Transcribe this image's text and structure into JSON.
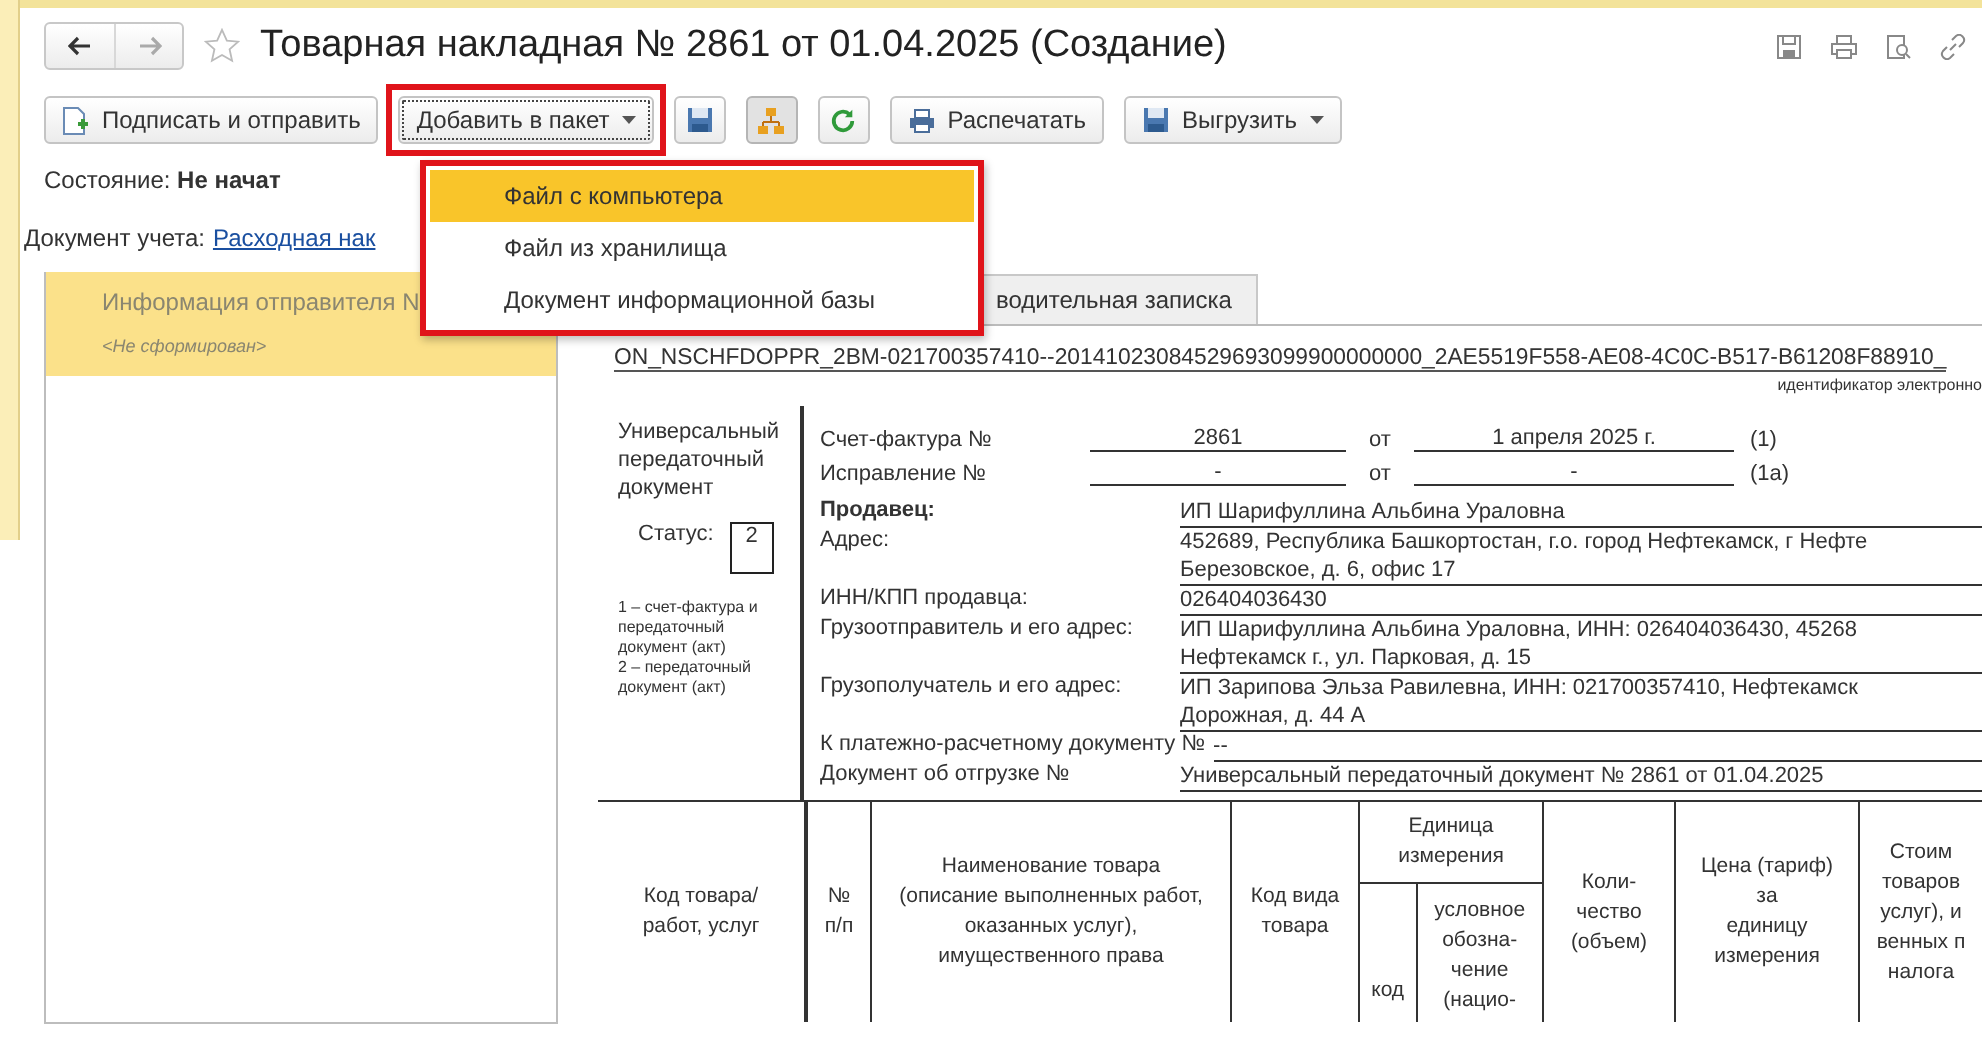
{
  "window": {
    "title": "Товарная накладная № 2861 от 01.04.2025 (Создание)"
  },
  "toolbar": [
    {
      "kind": "sign",
      "label": "Подписать и отправить",
      "pressed": false,
      "highlighted": false
    },
    {
      "kind": "add",
      "label": "Добавить в пакет",
      "pressed": false,
      "highlighted": true
    },
    {
      "kind": "save",
      "pressed": false,
      "highlighted": false
    },
    {
      "kind": "structure",
      "pressed": true,
      "highlighted": false
    },
    {
      "kind": "refresh",
      "pressed": false,
      "highlighted": false
    },
    {
      "kind": "print",
      "label": "Распечатать",
      "pressed": false,
      "highlighted": false
    },
    {
      "kind": "export",
      "label": "Выгрузить",
      "pressed": false,
      "highlighted": false
    }
  ],
  "menu": {
    "highlighted": true,
    "items": [
      {
        "label": "Файл с компьютера",
        "selected": true
      },
      {
        "label": "Файл из хранилища",
        "selected": false
      },
      {
        "label": "Документ информационной базы",
        "selected": false
      }
    ]
  },
  "state": "Состояние: **Не начат**",
  "document_link": {
    "label": "Документ учета:",
    "link": "Расходная нак"
  },
  "sender_panel": {
    "title": "Информация отправителя N",
    "value": "<Не сформирован>"
  },
  "tabs": [
    {
      "label": "водительная записка",
      "selected": false
    }
  ],
  "document": {
    "file_id": "ON_NSCHFDOPPR_2BM-021700357410--20141023084529693099900000000_2AE5519F558-AE08-4C0C-B517-B61208F88910_",
    "file_id_caption": "идентификатор электронно",
    "doc_type": "Универсальный передаточный документ",
    "status_label": "Статус:",
    "status_value": "2",
    "status_notes": [
      "1 – счет-фактура и передаточный документ (акт)",
      "2 – передаточный документ (акт)"
    ],
    "numbers": [
      {
        "label": "Счет-фактура №",
        "number": "2861",
        "from": "от",
        "date": "1 апреля 2025 г.",
        "ref": "(1)"
      },
      {
        "label": "Исправление №",
        "number": "-",
        "from": "от",
        "date": "-",
        "ref": "(1а)"
      }
    ],
    "fields": [
      {
        "label": "Продавец:",
        "bold": true,
        "lines": [
          "ИП Шарифуллина Альбина Ураловна"
        ]
      },
      {
        "label": "Адрес:",
        "bold": false,
        "lines": [
          "452689, Республика Башкортостан, г.о. город Нефтекамск, г Нефте",
          "Березовское, д. 6, офис 17"
        ]
      },
      {
        "label": "ИНН/КПП продавца:",
        "bold": false,
        "lines": [
          "026404036430"
        ]
      },
      {
        "label": "Грузоотправитель и его адрес:",
        "bold": false,
        "lines": [
          "ИП Шарифуллина Альбина Ураловна, ИНН: 026404036430, 45268",
          "Нефтекамск г., ул. Парковая, д. 15"
        ]
      },
      {
        "label": "Грузополучатель и его адрес:",
        "bold": false,
        "lines": [
          "ИП Зарипова Эльза Равилевна, ИНН: 021700357410, Нефтекамск",
          "Дорожная, д. 44 А"
        ]
      },
      {
        "label": "К платежно-расчетному документу №",
        "bold": false,
        "lines": [
          "--"
        ]
      },
      {
        "label": "Документ об отгрузке №",
        "bold": false,
        "lines": [
          "Универсальный передаточный документ № 2861 от 01.04.2025"
        ]
      }
    ],
    "table_columns": [
      {
        "kind": "single",
        "lines": [
          "Код товара/",
          "работ, услуг"
        ]
      },
      {
        "kind": "single",
        "lines": [
          "№",
          "п/п"
        ]
      },
      {
        "kind": "single",
        "lines": [
          "Наименование товара",
          "(описание выполненных работ,",
          "оказанных услуг),",
          "имущественного права"
        ]
      },
      {
        "kind": "single",
        "lines": [
          "Код вида",
          "товара"
        ]
      },
      {
        "kind": "group",
        "lines": [
          "Единица",
          "измерения"
        ],
        "sub": [
          {
            "lines": [
              "код"
            ]
          },
          {
            "lines": [
              "условное",
              "обозна-",
              "чение",
              "(нацио-"
            ]
          }
        ]
      },
      {
        "kind": "single",
        "lines": [
          "Коли-",
          "чество",
          "(объем)"
        ]
      },
      {
        "kind": "single",
        "lines": [
          "Цена (тариф)",
          "за",
          "единицу",
          "измерения"
        ]
      },
      {
        "kind": "single",
        "lines": [
          "Стоим",
          "товаров",
          "услуг), и",
          "венных п",
          "налога"
        ]
      }
    ]
  }
}
